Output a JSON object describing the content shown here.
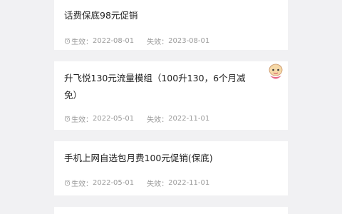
{
  "items": [
    {
      "title": "话费保底98元促销",
      "effective_label": "生效：",
      "effective_date": "2022-08-01",
      "expire_label": "失效：",
      "expire_date": "2023-08-01"
    },
    {
      "title": "升飞悦130元流量模组（100升130，6个月减免）",
      "effective_label": "生效：",
      "effective_date": "2022-05-01",
      "expire_label": "失效：",
      "expire_date": "2022-11-01"
    },
    {
      "title": "手机上网自选包月费100元促销(保底)",
      "effective_label": "生效：",
      "effective_date": "2022-05-01",
      "expire_label": "失效：",
      "expire_date": "2022-11-01"
    }
  ],
  "icons": {
    "clock": "clock-icon",
    "sticker": "cartoon-sticker"
  },
  "colors": {
    "background": "#f1f1f3",
    "card": "#ffffff",
    "title": "#1f1f1f",
    "meta": "#9a9a9a"
  }
}
